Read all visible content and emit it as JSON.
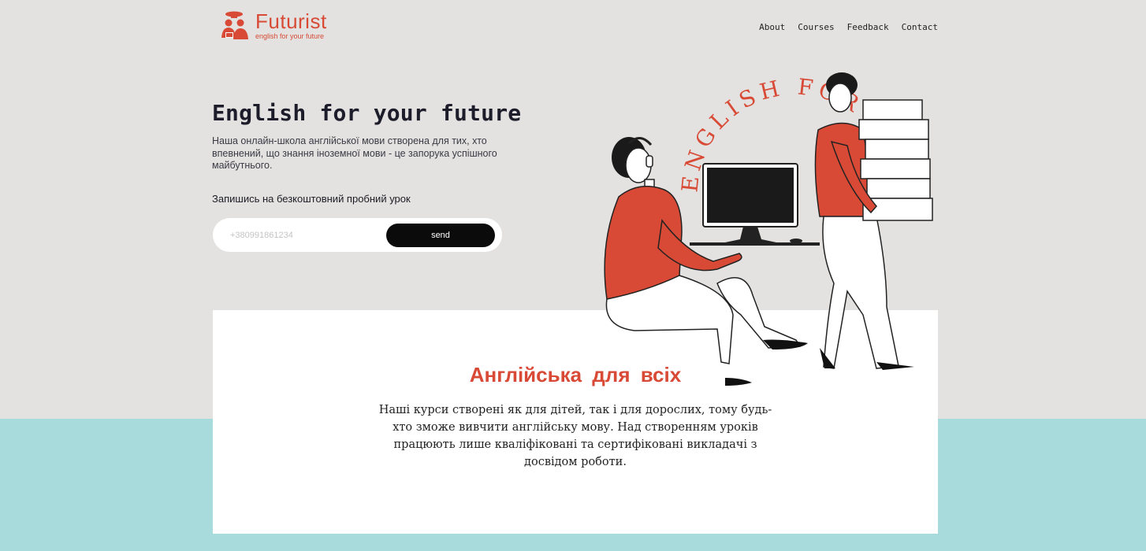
{
  "brand": {
    "name": "Futurist",
    "tagline": "english for your future",
    "accent_color": "#d84a35"
  },
  "nav": {
    "items": [
      "About",
      "Courses",
      "Feedback",
      "Contact"
    ]
  },
  "hero": {
    "title": "English for your future",
    "description": "Наша онлайн-школа англійської мови створена для тих, хто впевнений, що знання іноземної мови - це запорука успішного майбутнього.",
    "signup_label": "Запишись на безкоштовний пробний урок",
    "phone_placeholder": "+380991861234",
    "send_label": "send"
  },
  "illustration": {
    "curved_text": "ENGLISH FOR YOUR FUTURE"
  },
  "about": {
    "title": "Англійська для всіх",
    "text": "Наші курси створені як для дітей, так і для дорослих, тому будь-хто зможе вивчити англійську мову. Над створенням уроків працюють лише кваліфіковані та сертифіковані викладачі з досвідом роботи."
  },
  "colors": {
    "background": "#e3e2e0",
    "teal": "#a8dbdb",
    "accent": "#d84a35",
    "button": "#0b0b0b"
  }
}
